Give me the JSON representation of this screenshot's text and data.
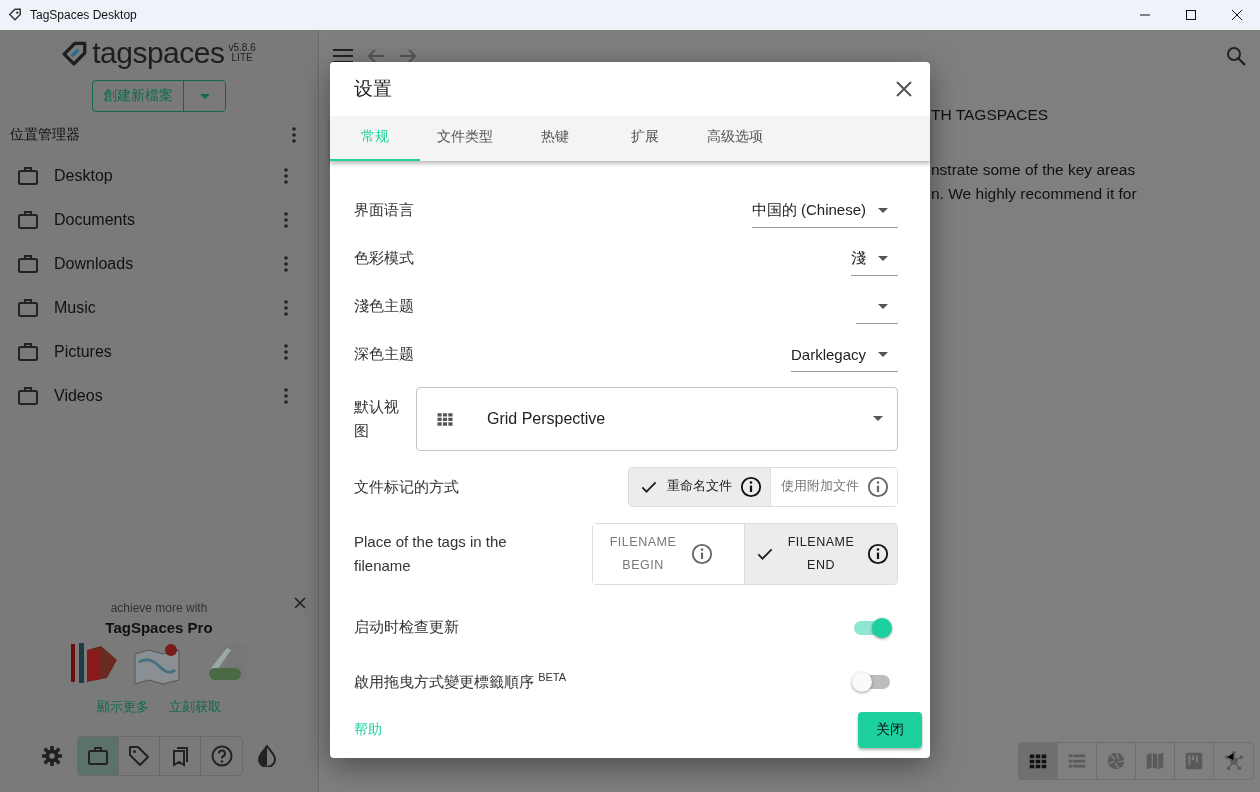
{
  "window": {
    "title": "TagSpaces Desktop"
  },
  "sidebar": {
    "logo": "tagspaces",
    "version": "v5.8.6",
    "edition": "LITE",
    "create_button": "創建新檔案",
    "locations_title": "位置管理器",
    "locations": [
      {
        "name": "Desktop"
      },
      {
        "name": "Documents"
      },
      {
        "name": "Downloads"
      },
      {
        "name": "Music"
      },
      {
        "name": "Pictures"
      },
      {
        "name": "Videos"
      }
    ],
    "promo": {
      "subtitle": "achieve more with",
      "title": "TagSpaces Pro",
      "links": [
        "顯示更多",
        "立刻获取"
      ]
    },
    "nav": [
      {
        "kind": "locations",
        "selected": true
      },
      {
        "kind": "tags",
        "selected": false
      },
      {
        "kind": "bookmarks",
        "selected": false
      },
      {
        "kind": "help",
        "selected": false
      }
    ]
  },
  "main": {
    "heading": "TH TAGSPACES",
    "lines": [
      "nstrate some of the key areas",
      "n. We highly recommend it for"
    ],
    "perspectives": [
      {
        "kind": "grid",
        "selected": true
      },
      {
        "kind": "list",
        "selected": false
      },
      {
        "kind": "gallery",
        "selected": false
      },
      {
        "kind": "map",
        "selected": false
      },
      {
        "kind": "kanban",
        "selected": false
      },
      {
        "kind": "graph",
        "selected": false
      }
    ]
  },
  "dialog": {
    "title": "设置",
    "tabs": [
      {
        "label": "常规",
        "selected": true
      },
      {
        "label": "文件类型",
        "selected": false
      },
      {
        "label": "热键",
        "selected": false
      },
      {
        "label": "扩展",
        "selected": false
      },
      {
        "label": "高级选项",
        "selected": false
      }
    ],
    "settings": [
      {
        "kind": "select",
        "label": "界面语言",
        "value": "中国的 (Chinese)"
      },
      {
        "kind": "select",
        "label": "色彩模式",
        "value": "淺"
      },
      {
        "kind": "select",
        "label": "淺色主题"
      },
      {
        "kind": "select",
        "label": "深色主题",
        "value": "Darklegacy"
      },
      {
        "kind": "view",
        "label": "默认视图",
        "value": "Grid Perspective"
      },
      {
        "kind": "toggles",
        "label": "文件标记的方式",
        "options": [
          {
            "label": "重命名文件",
            "selected": true
          },
          {
            "label": "使用附加文件",
            "selected": false
          }
        ]
      },
      {
        "kind": "toggles",
        "label": "Place of the tags in the filename",
        "options": [
          {
            "label": "FILENAME BEGIN",
            "selected": false
          },
          {
            "label": "FILENAME END",
            "selected": true
          }
        ]
      },
      {
        "kind": "switch",
        "label": "启动时检查更新",
        "on": true
      },
      {
        "kind": "switch",
        "label": "啟用拖曳方式變更標籤順序 $^{BETA}$",
        "on": false
      }
    ],
    "help": "帮助",
    "close": "关闭"
  }
}
